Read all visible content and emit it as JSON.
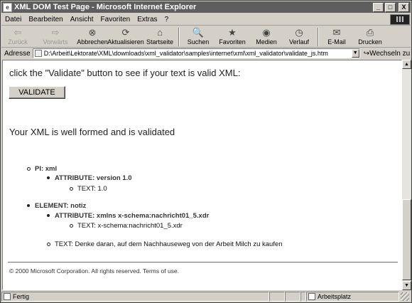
{
  "window": {
    "title": "XML DOM Test Page - Microsoft Internet Explorer",
    "app_icon": "e",
    "minimize_glyph": "_",
    "maximize_glyph": "□",
    "close_glyph": "X"
  },
  "menu": [
    "Datei",
    "Bearbeiten",
    "Ansicht",
    "Favoriten",
    "Extras",
    "?"
  ],
  "toolbar": {
    "back": {
      "label": "Zurück",
      "icon": "⇦"
    },
    "forward": {
      "label": "Vorwärts",
      "icon": "⇨"
    },
    "stop": {
      "label": "Abbrechen",
      "icon": "⊗"
    },
    "refresh": {
      "label": "Aktualisieren",
      "icon": "⟳"
    },
    "home": {
      "label": "Startseite",
      "icon": "⌂"
    },
    "search": {
      "label": "Suchen",
      "icon": "🔍"
    },
    "favorites": {
      "label": "Favoriten",
      "icon": "★"
    },
    "media": {
      "label": "Medien",
      "icon": "◉"
    },
    "history": {
      "label": "Verlauf",
      "icon": "◷"
    },
    "mail": {
      "label": "E-Mail",
      "icon": "✉"
    },
    "print": {
      "label": "Drucken",
      "icon": "⎙"
    }
  },
  "address": {
    "label": "Adresse",
    "url": "D:\\Arbeit\\Lektorate\\XML\\downloads\\xml_validator\\samples\\internet\\xml\\xml_validator\\validate_js.htm",
    "go_label": "Wechseln zu",
    "go_icon": "↪"
  },
  "page": {
    "intro": "click the \"Validate\" button to see if your text is valid XML:",
    "validate_button": "VALIDATE",
    "result": "Your XML is well formed and is validated",
    "tree": {
      "pi": "PI: xml",
      "pi_attribute": "ATTRIBUTE: version 1.0",
      "pi_text": "TEXT: 1.0",
      "element": "ELEMENT: notiz",
      "element_attribute": "ATTRIBUTE: xmlns x-schema:nachricht01_5.xdr",
      "element_attr_text": "TEXT: x-schema:nachricht01_5.xdr",
      "element_text": "TEXT: Denke daran, auf dem Nachhauseweg von der Arbeit Milch zu kaufen"
    },
    "copyright": "© 2000 Microsoft Corporation. All rights reserved. Terms of use."
  },
  "status": {
    "text": "Fertig",
    "zone": "Arbeitsplatz"
  }
}
